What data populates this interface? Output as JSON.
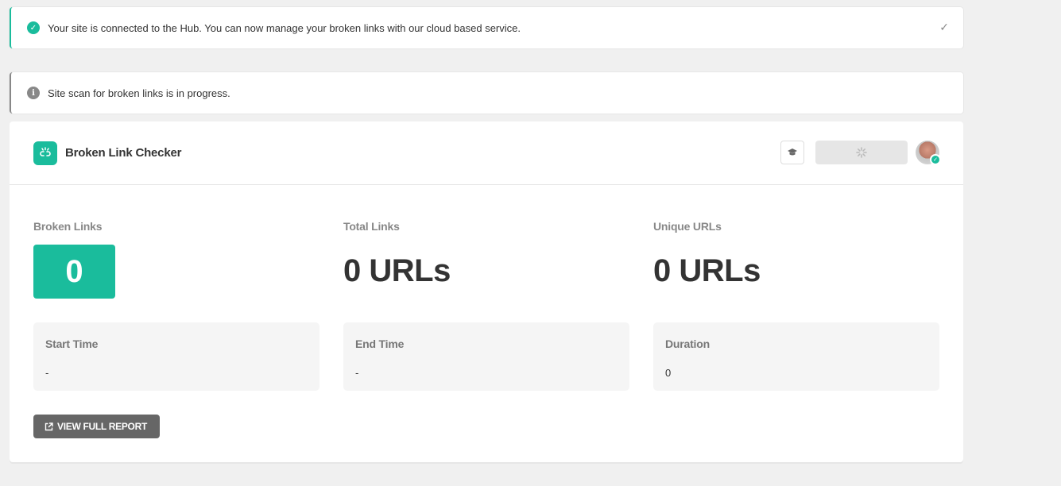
{
  "notices": {
    "hub": {
      "message": "Your site is connected to the Hub. You can now manage your broken links with our cloud based service.",
      "status_icon": "check-circle-icon",
      "dismiss_icon": "check-icon"
    },
    "scan": {
      "message": "Site scan for broken links is in progress.",
      "status_icon": "info-icon"
    }
  },
  "header": {
    "title": "Broken Link Checker",
    "logo_icon": "broken-link-icon",
    "docs_icon": "graduation-cap-icon",
    "loading_icon": "spinner-icon",
    "avatar": "user-avatar"
  },
  "stats": {
    "broken_links": {
      "label": "Broken Links",
      "value": "0"
    },
    "total_links": {
      "label": "Total Links",
      "value": "0 URLs"
    },
    "unique_urls": {
      "label": "Unique URLs",
      "value": "0 URLs"
    }
  },
  "times": {
    "start": {
      "label": "Start Time",
      "value": "-"
    },
    "end": {
      "label": "End Time",
      "value": "-"
    },
    "duration": {
      "label": "Duration",
      "value": "0"
    }
  },
  "actions": {
    "view_report": "VIEW FULL REPORT",
    "view_report_icon": "external-link-icon"
  },
  "colors": {
    "accent": "#1abc9c",
    "neutral": "#888888",
    "button_dark": "#666666",
    "background": "#f0f0f0"
  }
}
